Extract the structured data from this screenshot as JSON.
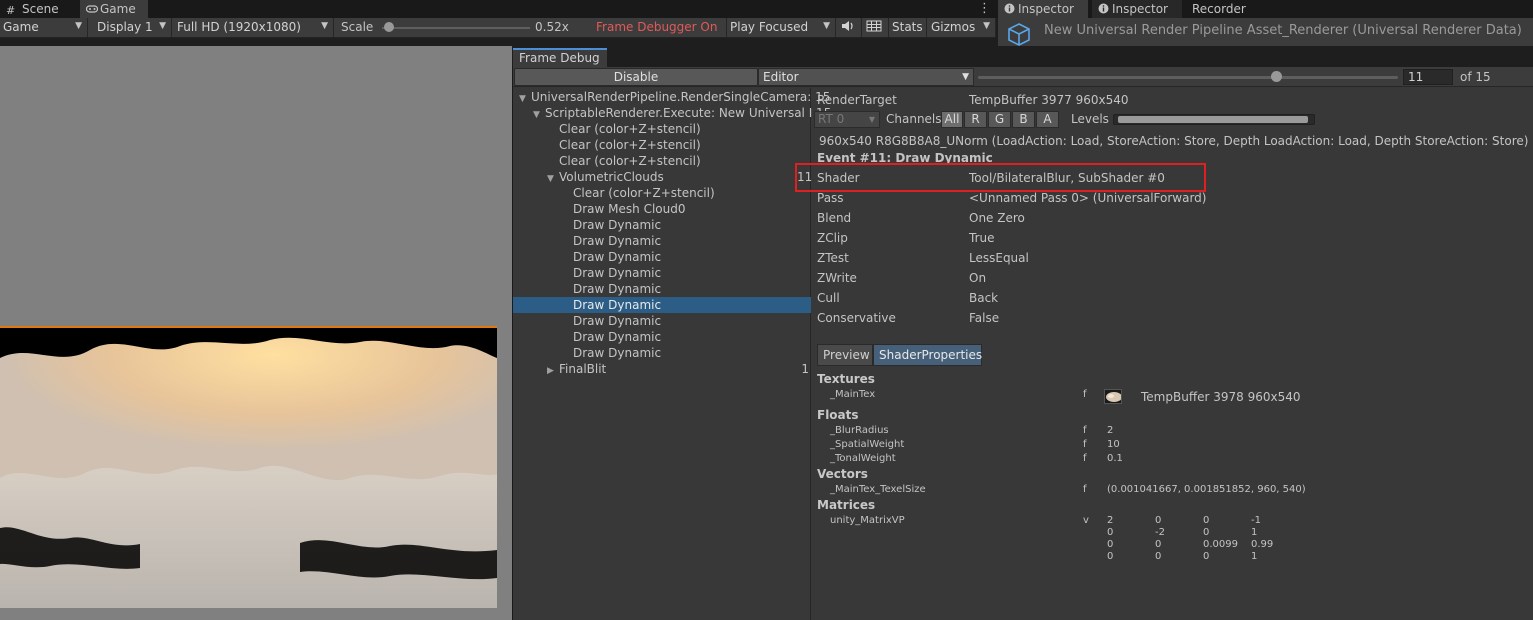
{
  "tabs": {
    "scene": "Scene",
    "game": "Game",
    "inspector1": "Inspector",
    "inspector2": "Inspector",
    "recorder": "Recorder"
  },
  "game_toolbar": {
    "view_mode": "Game",
    "display": "Display 1",
    "resolution": "Full HD (1920x1080)",
    "scale_label": "Scale",
    "scale_value": "0.52x",
    "scale_fraction": 0.05,
    "frame_debugger_status": "Frame Debugger On",
    "play_mode": "Play Focused",
    "stats": "Stats",
    "gizmos": "Gizmos"
  },
  "inspector": {
    "title": "New Universal Render Pipeline Asset_Renderer (Universal Renderer Data)"
  },
  "frame_debug": {
    "tab_label": "Frame Debug",
    "disable_label": "Disable",
    "target_dropdown": "Editor",
    "event_value": "11",
    "event_of": "of 15",
    "event_fraction": 0.71,
    "tree": [
      {
        "label": "UniversalRenderPipeline.RenderSingleCamera: 15",
        "depth": 0,
        "arrow": "▼",
        "count": "",
        "selected": false
      },
      {
        "label": "ScriptableRenderer.Execute: New Universal I 15",
        "depth": 1,
        "arrow": "▼",
        "count": "",
        "selected": false
      },
      {
        "label": "Clear (color+Z+stencil)",
        "depth": 2,
        "arrow": "",
        "count": "",
        "selected": false
      },
      {
        "label": "Clear (color+Z+stencil)",
        "depth": 2,
        "arrow": "",
        "count": "",
        "selected": false
      },
      {
        "label": "Clear (color+Z+stencil)",
        "depth": 2,
        "arrow": "",
        "count": "",
        "selected": false
      },
      {
        "label": "VolumetricClouds",
        "depth": 2,
        "arrow": "▼",
        "count": "",
        "selected": false
      },
      {
        "label": "Clear (color+Z+stencil)",
        "depth": 3,
        "arrow": "",
        "count": "",
        "selected": false
      },
      {
        "label": "Draw Mesh Cloud0",
        "depth": 3,
        "arrow": "",
        "count": "",
        "selected": false
      },
      {
        "label": "Draw Dynamic",
        "depth": 3,
        "arrow": "",
        "count": "",
        "selected": false
      },
      {
        "label": "Draw Dynamic",
        "depth": 3,
        "arrow": "",
        "count": "",
        "selected": false
      },
      {
        "label": "Draw Dynamic",
        "depth": 3,
        "arrow": "",
        "count": "",
        "selected": false
      },
      {
        "label": "Draw Dynamic",
        "depth": 3,
        "arrow": "",
        "count": "",
        "selected": false
      },
      {
        "label": "Draw Dynamic",
        "depth": 3,
        "arrow": "",
        "count": "",
        "selected": false
      },
      {
        "label": "Draw Dynamic",
        "depth": 3,
        "arrow": "",
        "count": "",
        "selected": true
      },
      {
        "label": "Draw Dynamic",
        "depth": 3,
        "arrow": "",
        "count": "",
        "selected": false
      },
      {
        "label": "Draw Dynamic",
        "depth": 3,
        "arrow": "",
        "count": "",
        "selected": false
      },
      {
        "label": "Draw Dynamic",
        "depth": 3,
        "arrow": "",
        "count": "",
        "selected": false
      },
      {
        "label": "FinalBlit",
        "depth": 2,
        "arrow": "▶",
        "count": "1",
        "selected": false
      }
    ],
    "render_target_label": "RenderTarget",
    "render_target_value": "TempBuffer 3977 960x540",
    "rt_dropdown": "RT 0",
    "channels_label": "Channels",
    "channels": [
      "All",
      "R",
      "G",
      "B",
      "A"
    ],
    "levels_label": "Levels",
    "format_line": "960x540 R8G8B8A8_UNorm (LoadAction: Load, StoreAction: Store, Depth LoadAction: Load, Depth StoreAction: Store)",
    "event_title": "Event #11: Draw Dynamic",
    "highlight_number": "11",
    "details": [
      {
        "label": "Shader",
        "value": "Tool/BilateralBlur, SubShader #0"
      },
      {
        "label": "Pass",
        "value": "<Unnamed Pass 0> (UniversalForward)"
      },
      {
        "label": "Blend",
        "value": "One Zero"
      },
      {
        "label": "ZClip",
        "value": "True"
      },
      {
        "label": "ZTest",
        "value": "LessEqual"
      },
      {
        "label": "ZWrite",
        "value": "On"
      },
      {
        "label": "Cull",
        "value": "Back"
      },
      {
        "label": "Conservative",
        "value": "False"
      }
    ],
    "subtabs": {
      "preview": "Preview",
      "shader_properties": "ShaderProperties"
    },
    "textures_header": "Textures",
    "textures": [
      {
        "name": "_MainTex",
        "type": "f",
        "value": "TempBuffer 3978 960x540"
      }
    ],
    "floats_header": "Floats",
    "floats": [
      {
        "name": "_BlurRadius",
        "type": "f",
        "value": "2"
      },
      {
        "name": "_SpatialWeight",
        "type": "f",
        "value": "10"
      },
      {
        "name": "_TonalWeight",
        "type": "f",
        "value": "0.1"
      }
    ],
    "vectors_header": "Vectors",
    "vectors": [
      {
        "name": "_MainTex_TexelSize",
        "type": "f",
        "value": "(0.001041667, 0.001851852, 960, 540)"
      }
    ],
    "matrices_header": "Matrices",
    "matrices": [
      {
        "name": "unity_MatrixVP",
        "type": "v",
        "rows": [
          [
            "2",
            "0",
            "0",
            "-1"
          ],
          [
            "0",
            "-2",
            "0",
            "1"
          ],
          [
            "0",
            "0",
            "0.0099",
            "0.99"
          ],
          [
            "0",
            "0",
            "0",
            "1"
          ]
        ]
      }
    ]
  },
  "colors": {
    "accent_tab": "#4d8fd6",
    "frame_debugger_on": "#e05a5a",
    "selection": "#2c5d87",
    "highlight_box": "#e02020",
    "orange_strip": "#e07a10"
  },
  "icons": {
    "scene": "hash-icon",
    "game": "gamepad-icon",
    "inspector": "info-icon",
    "asset": "cube-icon",
    "audio": "speaker-icon",
    "stats_grid": "grid-icon",
    "menu": "kebab-icon"
  }
}
